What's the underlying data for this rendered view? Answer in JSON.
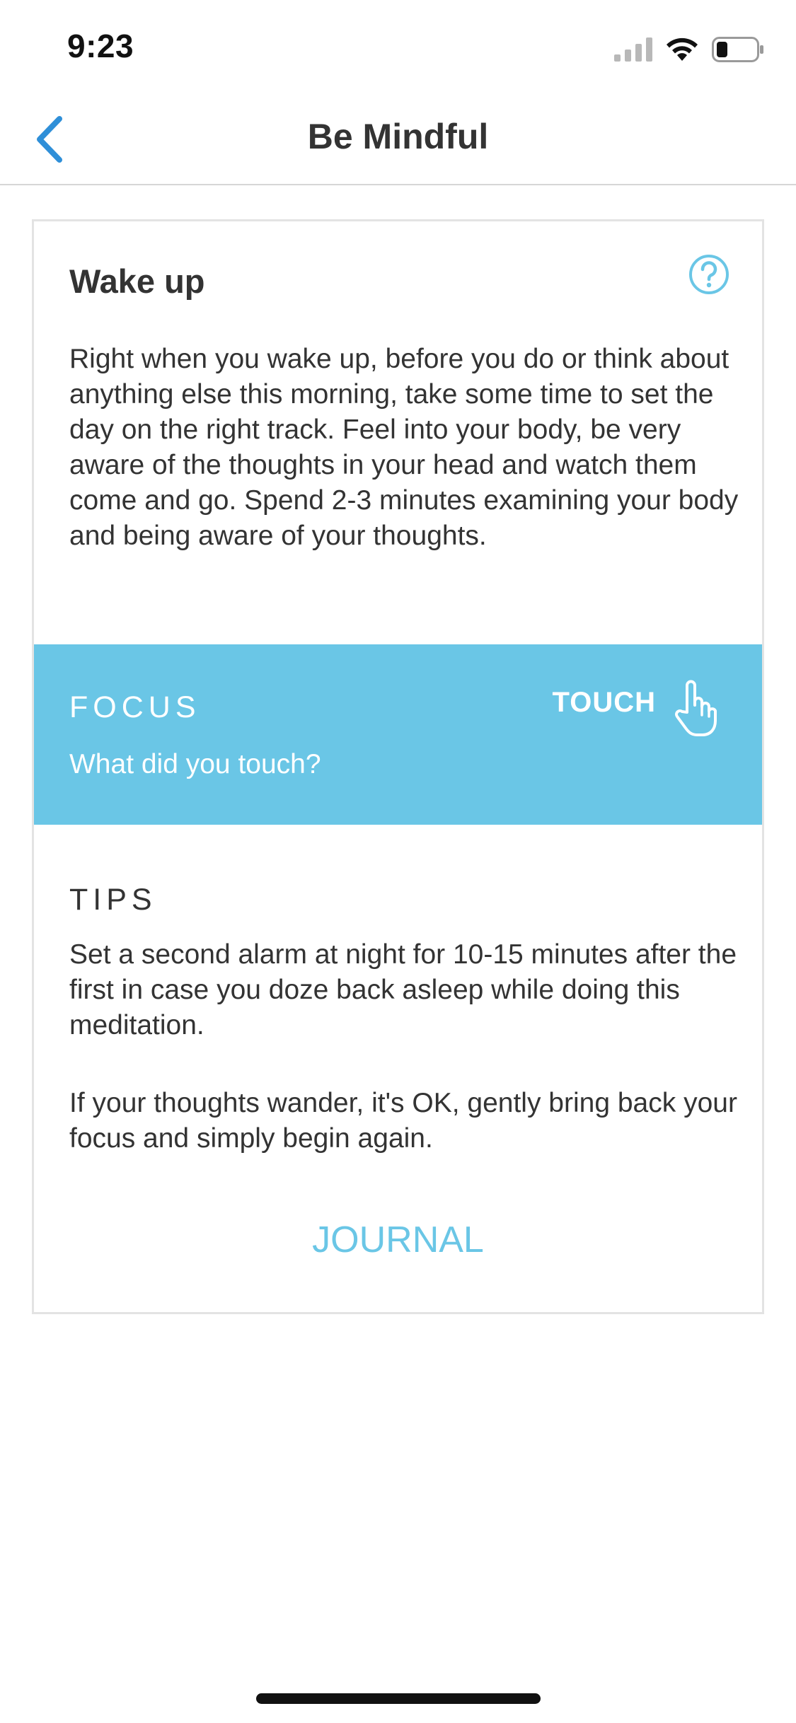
{
  "status_bar": {
    "time": "9:23",
    "icons": [
      "cellular-signal-icon",
      "wifi-icon",
      "battery-icon"
    ]
  },
  "nav": {
    "title": "Be Mindful",
    "back_icon": "chevron-left-icon"
  },
  "card": {
    "title": "Wake up",
    "help_icon": "question-circle-icon",
    "description": "Right when you wake up, before you do or think about anything else this morning, take some time to set the day on the right track. Feel into your body, be very aware of the thoughts in your head and watch them come and go. Spend 2-3 minutes examining your body and being aware of your thoughts.",
    "focus": {
      "label": "FOCUS",
      "question": "What did you touch?",
      "sense_label": "TOUCH",
      "sense_icon": "hand-pointer-icon"
    },
    "tips": {
      "label": "TIPS",
      "items": [
        "Set a second alarm at night for 10-15 minutes after the first in case you doze back asleep while doing this meditation.",
        "If your thoughts wander, it's OK, gently bring back your focus and simply begin again."
      ]
    },
    "journal_label": "JOURNAL"
  },
  "colors": {
    "accent": "#6ac6e6",
    "back_chevron": "#2f8fd8",
    "text": "#333333",
    "card_border": "#e3e3e3"
  }
}
